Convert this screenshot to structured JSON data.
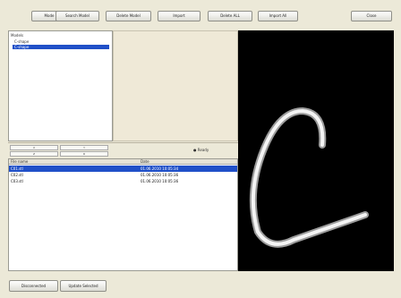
{
  "toolbar": {
    "buttons": [
      "Mode",
      "Search Model",
      "Delete Model",
      "Import",
      "Delete ALL",
      "Import All",
      "Close"
    ]
  },
  "tree": {
    "root": "Models",
    "items": [
      {
        "label": "C-shape",
        "selected": false
      },
      {
        "label": "C-shape",
        "selected": true
      }
    ]
  },
  "controls": {
    "tabs": [
      "X",
      "Y",
      "Z",
      "R"
    ],
    "status": "● Ready"
  },
  "file_list": {
    "headers": [
      "File name",
      "Date"
    ],
    "rows": [
      {
        "name": "C01.stl",
        "date": "01.06.2010 10:05:34",
        "selected": true
      },
      {
        "name": "C02.stl",
        "date": "01.06.2010 10:05:36",
        "selected": false
      },
      {
        "name": "C03.stl",
        "date": "01.06.2010 10:05:36",
        "selected": false
      }
    ]
  },
  "viewer": {
    "background": "#000000",
    "model": "c-shaped-tube-icon"
  },
  "footer": {
    "buttons": [
      "Disconnected",
      "Update Selected"
    ]
  }
}
